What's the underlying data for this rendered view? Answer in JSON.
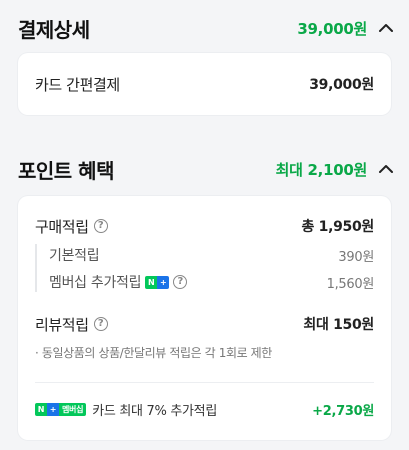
{
  "payment": {
    "title": "결제상세",
    "total": "39,000원",
    "method_label": "카드 간편결제",
    "method_amount": "39,000원"
  },
  "points": {
    "title": "포인트 혜택",
    "total": "최대 2,100원",
    "purchase": {
      "label": "구매적립",
      "value": "총 1,950원",
      "basic_label": "기본적립",
      "basic_value": "390원",
      "membership_label": "멤버십 추가적립",
      "membership_value": "1,560원"
    },
    "review": {
      "label": "리뷰적립",
      "value": "최대 150원",
      "note": "· 동일상품의 상품/한달리뷰 적립은 각 1회로 제한"
    },
    "card": {
      "badge_text": "멤버십",
      "label": "카드 최대 7% 추가적립",
      "value": "+2,730원"
    }
  },
  "icons": {
    "help": "?",
    "badge_n": "N",
    "badge_plus": "+"
  },
  "colors": {
    "accent_green": "#0aa848",
    "background": "#f4f5f7"
  }
}
